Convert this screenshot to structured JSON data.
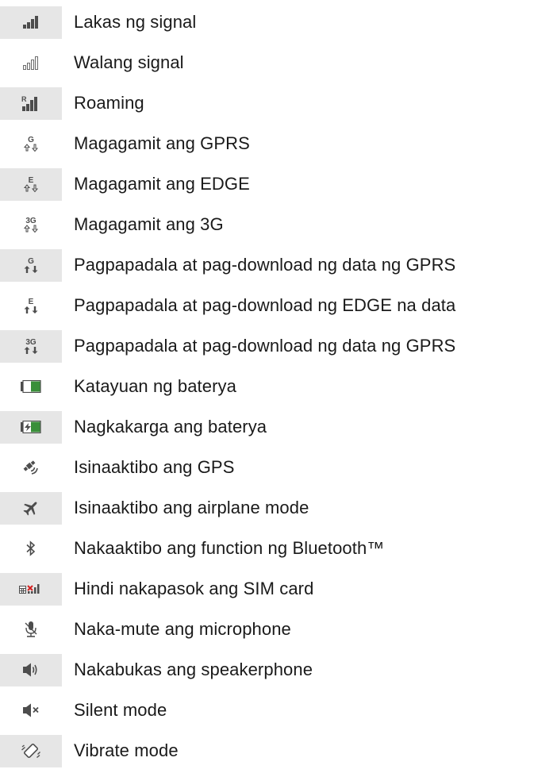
{
  "items": [
    {
      "icon": "signal-strength-icon",
      "label": "Lakas ng signal"
    },
    {
      "icon": "no-signal-icon",
      "label": "Walang signal"
    },
    {
      "icon": "roaming-icon",
      "label": "Roaming"
    },
    {
      "icon": "gprs-available-icon",
      "label": "Magagamit ang GPRS"
    },
    {
      "icon": "edge-available-icon",
      "label": "Magagamit ang EDGE"
    },
    {
      "icon": "3g-available-icon",
      "label": "Magagamit ang 3G"
    },
    {
      "icon": "gprs-data-transfer-icon",
      "label": "Pagpapadala at pag-download ng data ng GPRS"
    },
    {
      "icon": "edge-data-transfer-icon",
      "label": "Pagpapadala at pag-download ng EDGE na data"
    },
    {
      "icon": "3g-data-transfer-icon",
      "label": "Pagpapadala at pag-download ng data ng GPRS"
    },
    {
      "icon": "battery-status-icon",
      "label": "Katayuan ng baterya"
    },
    {
      "icon": "battery-charging-icon",
      "label": "Nagkakarga ang baterya"
    },
    {
      "icon": "gps-icon",
      "label": "Isinaaktibo ang GPS"
    },
    {
      "icon": "airplane-mode-icon",
      "label": "Isinaaktibo ang airplane mode"
    },
    {
      "icon": "bluetooth-icon",
      "label": "Nakaaktibo ang function ng Bluetooth™"
    },
    {
      "icon": "no-sim-card-icon",
      "label": "Hindi nakapasok ang SIM card"
    },
    {
      "icon": "microphone-muted-icon",
      "label": "Naka-mute ang microphone"
    },
    {
      "icon": "speakerphone-on-icon",
      "label": "Nakabukas ang speakerphone"
    },
    {
      "icon": "silent-mode-icon",
      "label": "Silent mode"
    },
    {
      "icon": "vibrate-mode-icon",
      "label": "Vibrate mode"
    }
  ],
  "icon_color": "#4d4d4d",
  "battery_green": "#3a8f3a",
  "sim_x_color": "#d42020",
  "shade_color": "#e6e6e6"
}
